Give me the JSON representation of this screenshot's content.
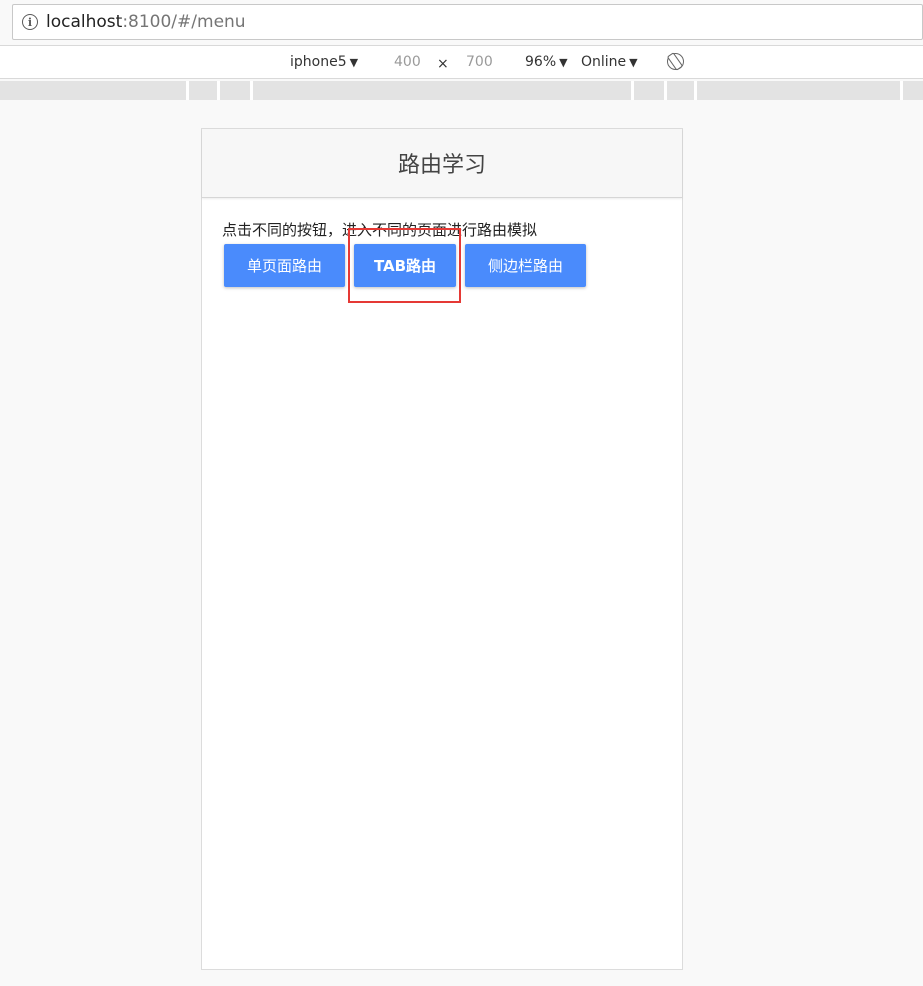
{
  "browser": {
    "url_host": "localhost",
    "url_rest": ":8100/#/menu"
  },
  "device_toolbar": {
    "device": "iphone5",
    "width": "400",
    "separator": "×",
    "height": "700",
    "zoom": "96%",
    "network": "Online",
    "caret": "▼"
  },
  "app": {
    "title": "路由学习",
    "intro": "点击不同的按钮，进入不同的页面进行路由模拟",
    "buttons": {
      "single_page": "单页面路由",
      "tab": "TAB路由",
      "side_menu": "侧边栏路由"
    }
  },
  "colors": {
    "button": "#4a8bfc",
    "highlight": "#e53935"
  }
}
